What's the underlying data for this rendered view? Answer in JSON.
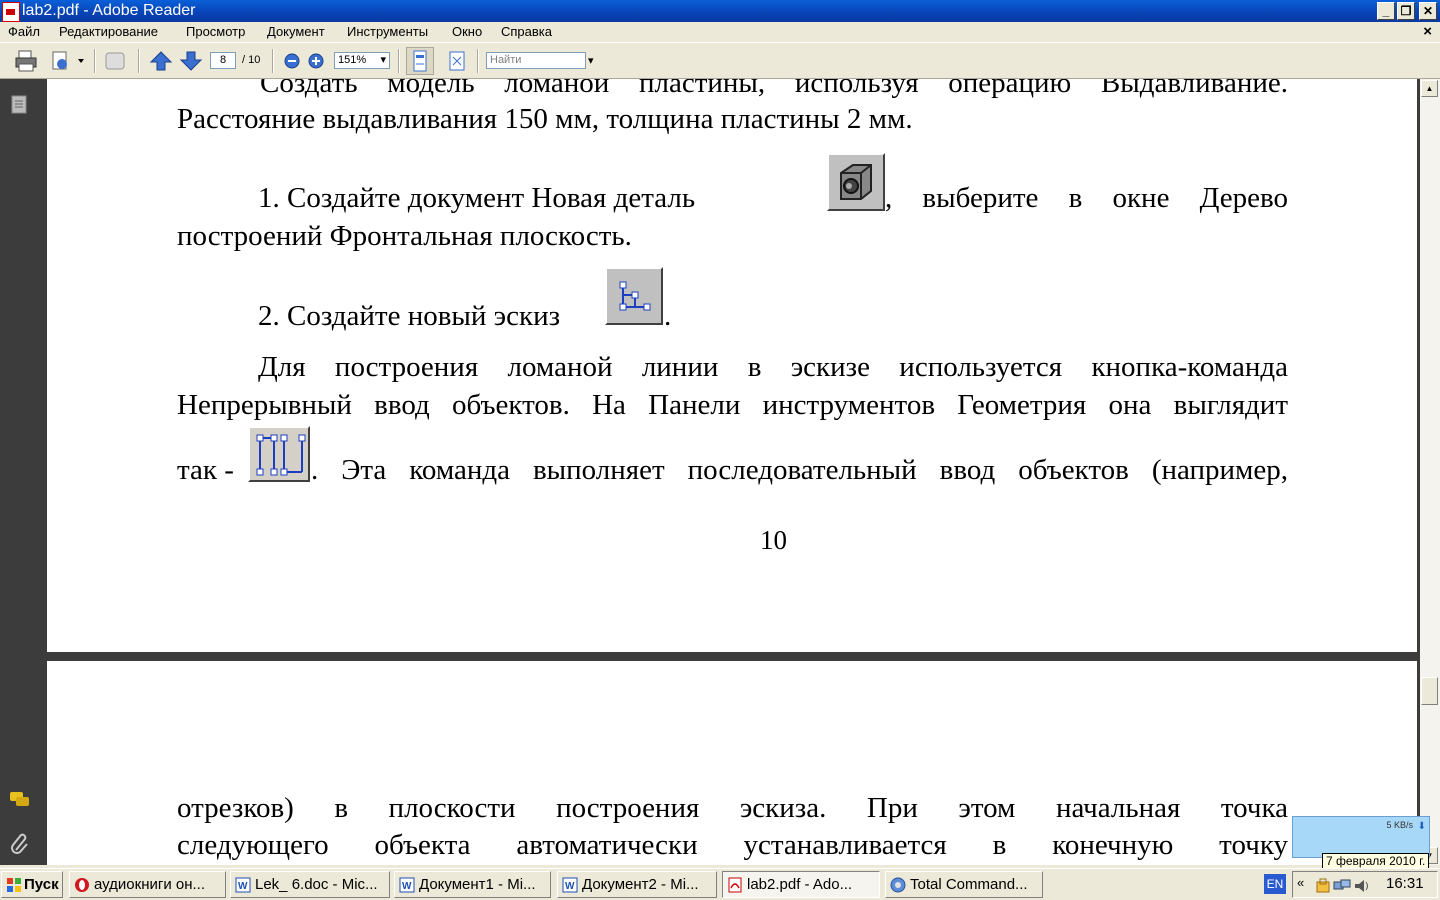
{
  "window": {
    "title": "lab2.pdf - Adobe Reader",
    "controls": [
      "_",
      "❐",
      "✕"
    ]
  },
  "menu": {
    "items": [
      "Файл",
      "Редактирование",
      "Просмотр",
      "Документ",
      "Инструменты",
      "Окно",
      "Справка"
    ],
    "close_doc": "×"
  },
  "toolbar": {
    "page_current": "8",
    "page_total": "/ 10",
    "zoom": "151%",
    "search_placeholder": "Найти"
  },
  "page1": {
    "line1": "Создать модель ломаной пластины, используя операцию Выдавливание.",
    "line2": "Расстояние выдавливания 150 мм, толщина пластины 2 мм.",
    "step1_before": "1. Создайте документ Новая деталь",
    "step1_after": ", выберите в окне Дерево",
    "step1_line2": "построений Фронтальная плоскость.",
    "step2_before": "2. Создайте новый эскиз",
    "step2_after": ".",
    "para_line1": "Для построения ломаной линии в эскизе используется кнопка-команда",
    "para_line2": "Непрерывный ввод объектов. На Панели инструментов Геометрия она выглядит",
    "para_line3_before": "так -",
    "para_line3_after": ". Эта команда выполняет последовательный ввод объектов (например,",
    "page_number": "10"
  },
  "page2": {
    "line1": "отрезков) в плоскости построения эскиза. При этом начальная точка",
    "line2": "следующего объекта автоматически устанавливается в конечную точку"
  },
  "taskbar": {
    "start": "Пуск",
    "tasks": [
      "аудиокниги он...",
      "Lek_ 6.doc - Mic...",
      "Документ1 - Mi...",
      "Документ2 - Mi...",
      "lab2.pdf - Ado...",
      "Total Command..."
    ],
    "lang": "EN",
    "tray_arrows": "«",
    "clock": "16:31",
    "net_speed": "5 KB/s",
    "date_tooltip": "7 февраля 2010 г."
  },
  "colors": {
    "titlebar": "#0842b4",
    "doc_background": "#3c3c3c",
    "page": "#ffffff"
  }
}
